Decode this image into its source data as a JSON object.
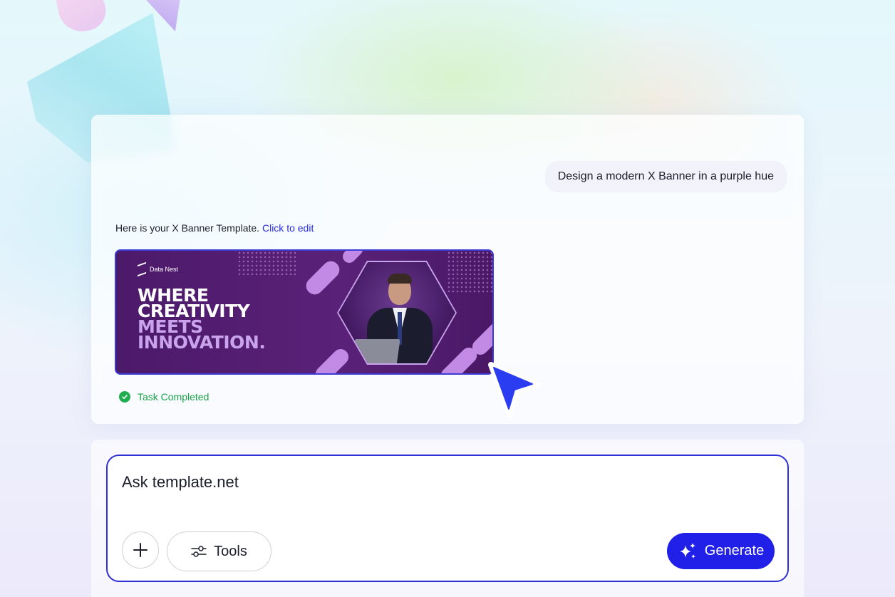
{
  "conversation": {
    "user_prompt": "Design a modern X Banner in a purple hue",
    "response_text": "Here is your X Banner Template.",
    "edit_link": "Click to edit",
    "status": "Task Completed"
  },
  "banner": {
    "brand": "Data Nest",
    "headline_line1": "WHERE",
    "headline_line2": "CREATIVITY",
    "headline_line3": "MEETS",
    "headline_line4": "INNOVATION."
  },
  "composer": {
    "placeholder": "Ask template.net",
    "tools_label": "Tools",
    "generate_label": "Generate"
  },
  "icons": {
    "plus": "plus-icon",
    "tools": "sliders-icon",
    "generate": "sparkles-icon",
    "status": "check-circle-icon",
    "cursor": "cursor-arrow-icon"
  },
  "colors": {
    "accent": "#2020e8",
    "banner_bg": "#4c1a6a",
    "banner_highlight": "#c9a3ec",
    "success": "#17a34a"
  }
}
